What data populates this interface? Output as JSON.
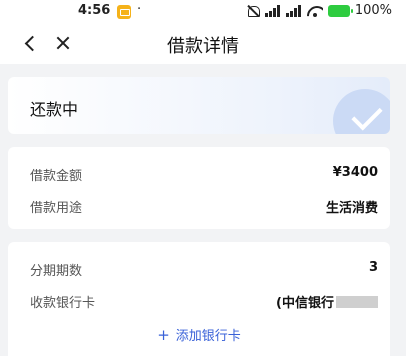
{
  "status_bar": {
    "time": "4:56",
    "dot": "·",
    "battery_percent": "100%"
  },
  "header": {
    "title": "借款详情"
  },
  "loan_status": {
    "label": "还款中"
  },
  "loan_info": {
    "amount_label": "借款金额",
    "amount_value": "¥3400",
    "purpose_label": "借款用途",
    "purpose_value": "生活消费"
  },
  "installment": {
    "periods_label": "分期期数",
    "periods_value": "3",
    "bank_label": "收款银行卡",
    "bank_value": "(中信银行",
    "add_card_label": "添加银行卡"
  },
  "colors": {
    "accent": "#3a62d8",
    "background": "#f2f3f5",
    "status_badge": "#cbdaf5"
  }
}
